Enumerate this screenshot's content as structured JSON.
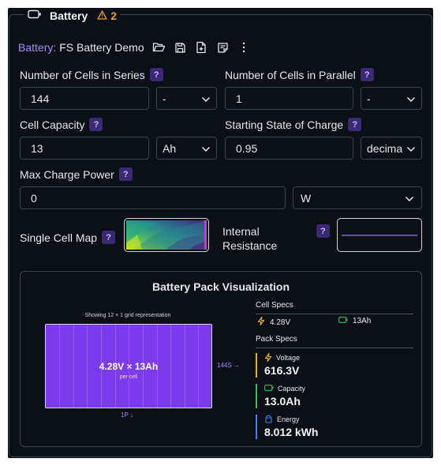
{
  "section": {
    "title": "Battery",
    "warning_count": "2"
  },
  "toolbar": {
    "prefix": "Battery:",
    "name": "FS Battery Demo",
    "icons": [
      "folder-open-icon",
      "save-icon",
      "new-file-icon",
      "notes-icon",
      "more-vertical-icon"
    ]
  },
  "fields": {
    "series": {
      "label": "Number of Cells in Series",
      "value": "144",
      "unit": "-"
    },
    "parallel": {
      "label": "Number of Cells in Parallel",
      "value": "1",
      "unit": "-"
    },
    "capacity": {
      "label": "Cell Capacity",
      "value": "13",
      "unit": "Ah"
    },
    "soc": {
      "label": "Starting State of Charge",
      "value": "0.95",
      "unit": "decimal"
    },
    "max_power": {
      "label": "Max Charge Power",
      "value": "0",
      "unit": "W"
    },
    "cell_map": {
      "label": "Single Cell Map"
    },
    "resistance": {
      "label": "Internal Resistance"
    },
    "help_glyph": "?"
  },
  "viz": {
    "title": "Battery Pack Visualization",
    "grid_caption": "Showing 12 × 1 grid representation",
    "pack_label": "4.28V × 13Ah",
    "pack_sublabel": "per cell",
    "series_tag": "144S →",
    "parallel_tag": "1P ↓",
    "cell_specs": {
      "heading": "Cell Specs",
      "voltage": "4.28V",
      "capacity": "13Ah"
    },
    "pack_specs": {
      "heading": "Pack Specs",
      "voltage_label": "Voltage",
      "voltage_value": "616.3V",
      "capacity_label": "Capacity",
      "capacity_value": "13.0Ah",
      "energy_label": "Energy",
      "energy_value": "8.012 kWh"
    }
  },
  "colors": {
    "accent": "#7c3aed",
    "warning": "#f59e0b",
    "voltage": "#eab308",
    "capacity": "#22c55e",
    "energy": "#3b82f6"
  }
}
